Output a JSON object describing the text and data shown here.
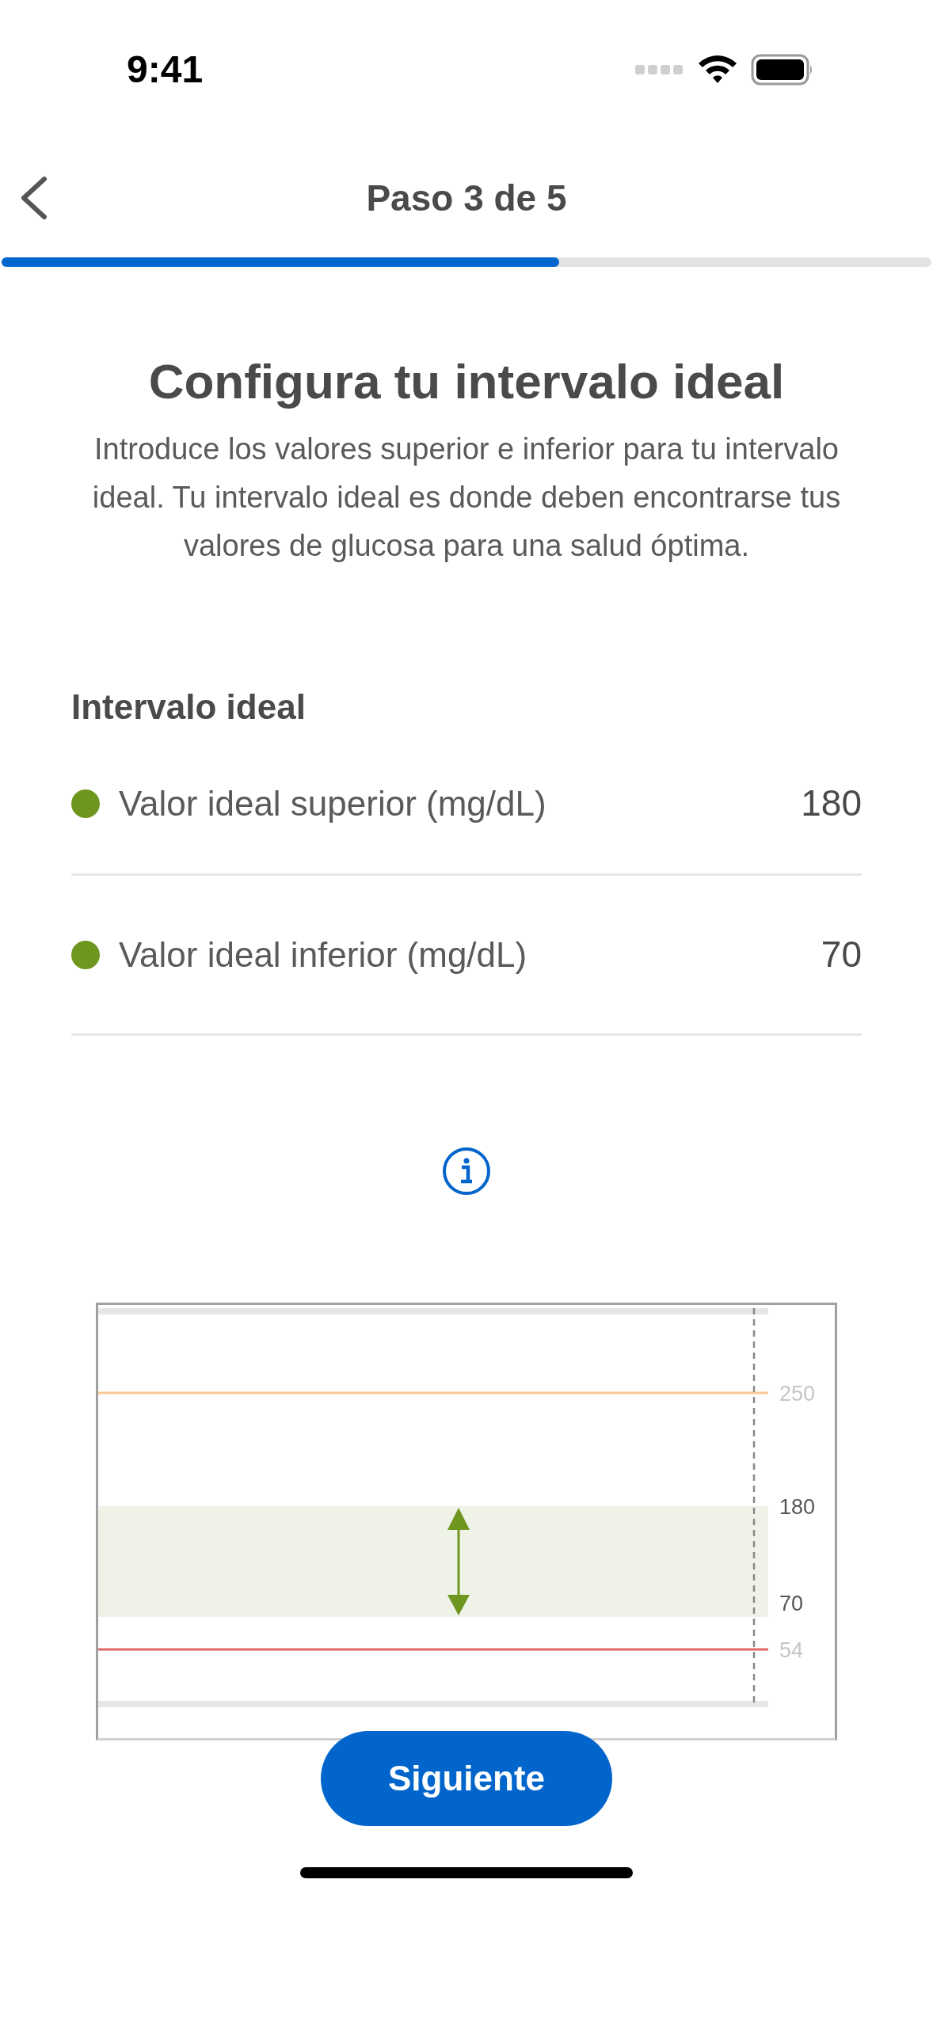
{
  "status_bar": {
    "time": "9:41"
  },
  "header": {
    "title": "Paso 3 de 5",
    "progress": {
      "level": 0.6
    }
  },
  "heading": "Configura tu intervalo ideal",
  "description": "Introduce los valores superior e inferior para tu intervalo ideal. Tu intervalo ideal es donde deben encontrarse tus valores de glucosa para una salud óptima.",
  "section_title": "Intervalo ideal",
  "fields": [
    {
      "label": "Valor ideal superior (mg/dL)",
      "value": "180"
    },
    {
      "label": "Valor ideal inferior (mg/dL)",
      "value": "70"
    }
  ],
  "range_diagram": {
    "labels": [
      {
        "kind": "high",
        "text": "250"
      },
      {
        "kind": "target_top",
        "text": "180"
      },
      {
        "kind": "target_bottom",
        "text": "70"
      },
      {
        "kind": "low",
        "text": "54"
      }
    ]
  },
  "next_button": "Siguiente"
}
